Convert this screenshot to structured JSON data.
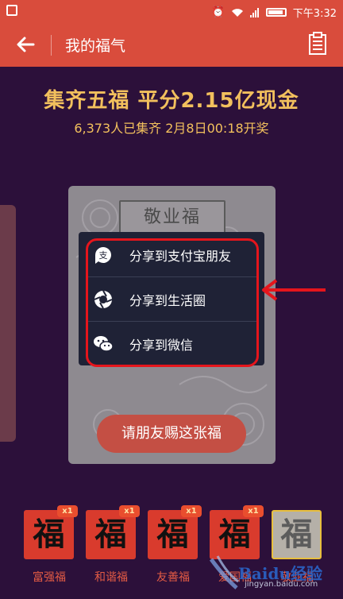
{
  "status": {
    "time": "下午3:32"
  },
  "app": {
    "title": "我的福气"
  },
  "banner": {
    "headline": "集齐五福 平分2.15亿现金",
    "subline": "6,373人已集齐 2月8日00:18开奖"
  },
  "card": {
    "name": "敬业福",
    "action": "请朋友赐这张福"
  },
  "share_menu": {
    "items": [
      {
        "label": "分享到支付宝朋友",
        "icon": "alipay-friends-icon"
      },
      {
        "label": "分享到生活圈",
        "icon": "life-circle-icon"
      },
      {
        "label": "分享到微信",
        "icon": "wechat-icon"
      }
    ]
  },
  "fu_cards": [
    {
      "glyph": "福",
      "label": "富强福",
      "count": "x1"
    },
    {
      "glyph": "福",
      "label": "和谐福",
      "count": "x1"
    },
    {
      "glyph": "福",
      "label": "友善福",
      "count": "x1"
    },
    {
      "glyph": "福",
      "label": "爱国福",
      "count": "x1"
    },
    {
      "glyph": "福",
      "label": "敬业福"
    }
  ],
  "watermark": {
    "brand": "Baidu经验",
    "url": "jingyan.baidu.com"
  },
  "colors": {
    "accent": "#d94c3c",
    "background": "#2c103a",
    "gold": "#f2c05d",
    "highlight": "#e5151c"
  }
}
